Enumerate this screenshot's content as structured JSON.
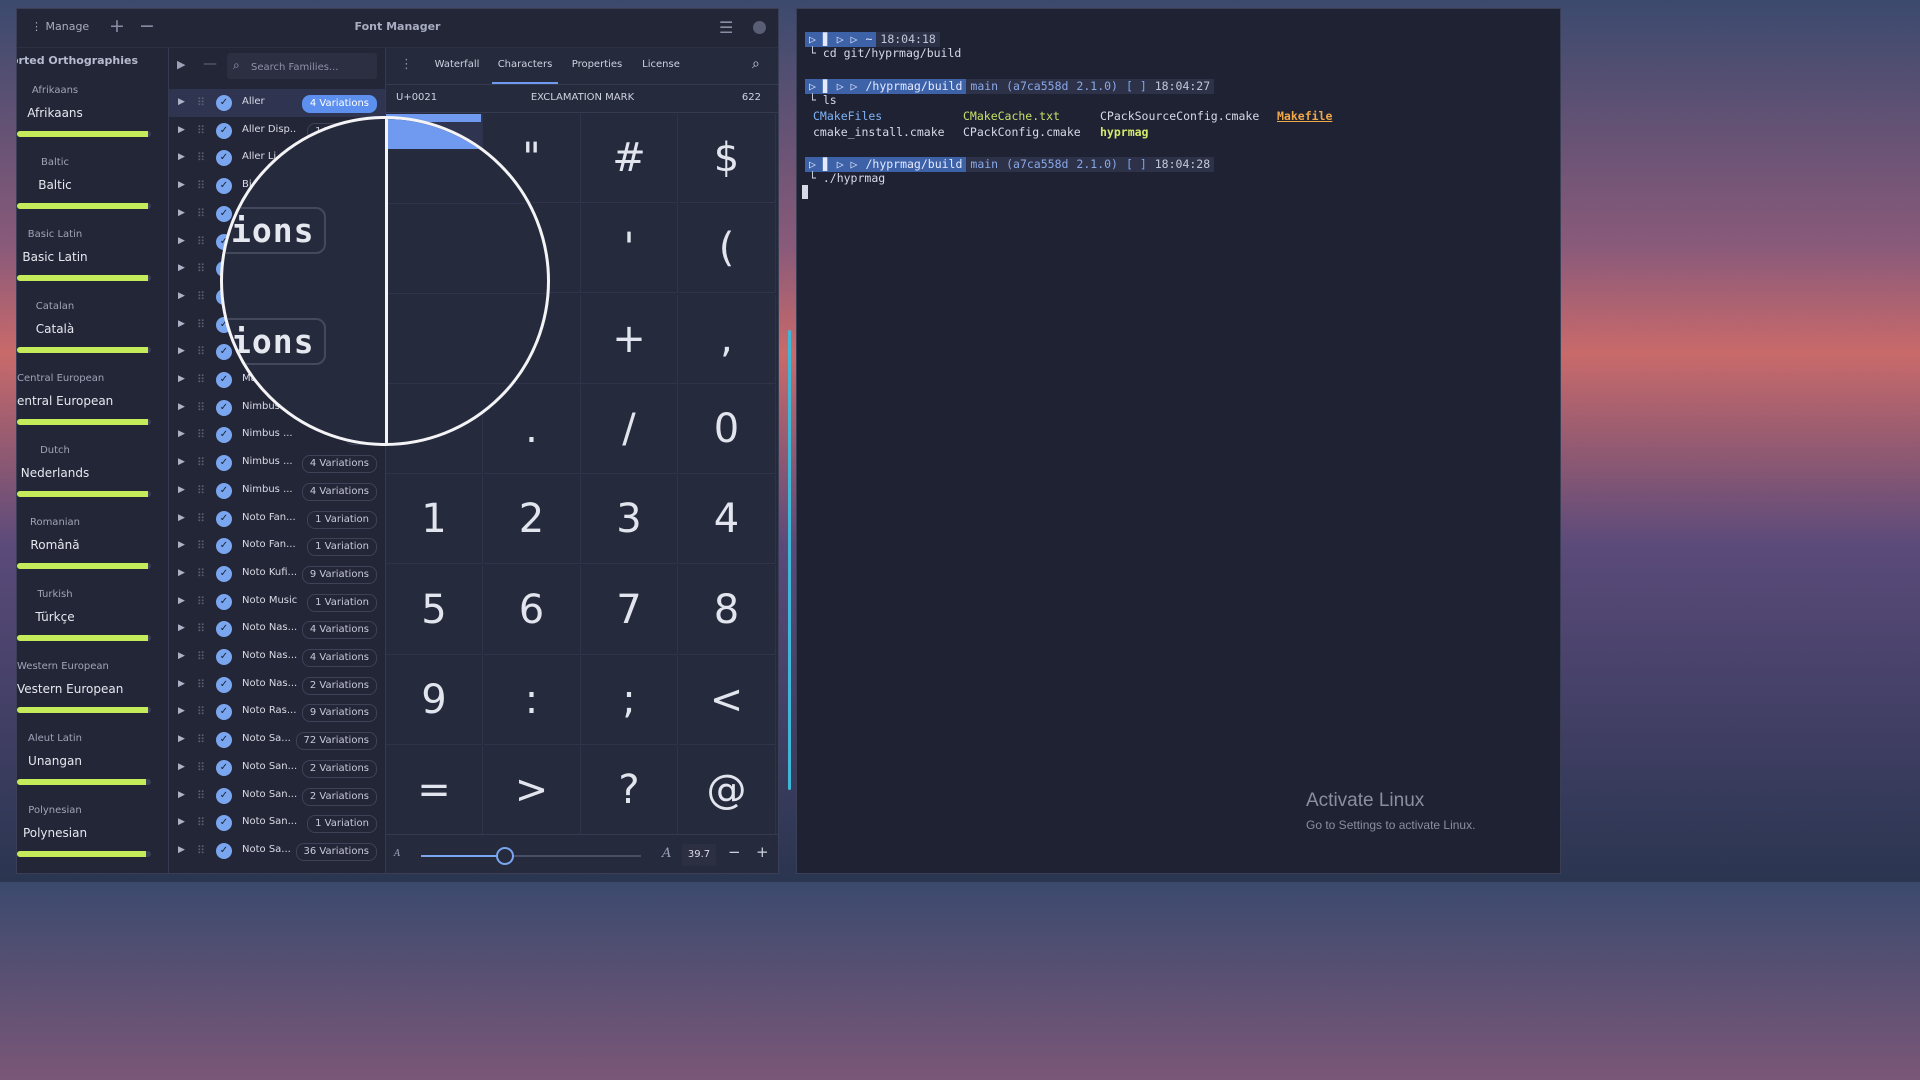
{
  "window": {
    "manage_label": "Manage",
    "title": "Font Manager"
  },
  "orthographies": {
    "heading": "orted Orthographies",
    "items": [
      {
        "label": "Afrikaans",
        "sample": "Afrikaans",
        "coverage": 0.98
      },
      {
        "label": "Baltic",
        "sample": "Baltic",
        "coverage": 0.98
      },
      {
        "label": "Basic Latin",
        "sample": "Basic Latin",
        "coverage": 0.98
      },
      {
        "label": "Catalan",
        "sample": "Català",
        "coverage": 0.98
      },
      {
        "label": "Central European",
        "sample": "entral European",
        "coverage": 0.98
      },
      {
        "label": "Dutch",
        "sample": "Nederlands",
        "coverage": 0.98
      },
      {
        "label": "Romanian",
        "sample": "Română",
        "coverage": 0.98
      },
      {
        "label": "Turkish",
        "sample": "Türkçe",
        "coverage": 0.98
      },
      {
        "label": "Western European",
        "sample": "Vestern European",
        "coverage": 0.98
      },
      {
        "label": "Aleut Latin",
        "sample": "Unangan",
        "coverage": 0.96
      },
      {
        "label": "Polynesian",
        "sample": "Polynesian",
        "coverage": 0.96
      }
    ]
  },
  "families": {
    "search_placeholder": "Search Families...",
    "rows": [
      {
        "name": "Aller",
        "badge": "4 Variations",
        "selected": true
      },
      {
        "name": "Aller Disp...",
        "badge": "1 Variation"
      },
      {
        "name": "Aller Li...",
        "badge": ""
      },
      {
        "name": "Bi...",
        "badge": ""
      },
      {
        "name": "",
        "badge": ""
      },
      {
        "name": "",
        "badge": ""
      },
      {
        "name": "",
        "badge": ""
      },
      {
        "name": "",
        "badge": ""
      },
      {
        "name": "",
        "badge": ""
      },
      {
        "name": "",
        "badge": ""
      },
      {
        "name": "Ma...",
        "badge": ""
      },
      {
        "name": "Nimbus",
        "badge": ""
      },
      {
        "name": "Nimbus ...",
        "badge": "4 V"
      },
      {
        "name": "Nimbus ...",
        "badge": "4 Variations"
      },
      {
        "name": "Nimbus ...",
        "badge": "4 Variations"
      },
      {
        "name": "Noto Fan...",
        "badge": "1 Variation"
      },
      {
        "name": "Noto Fan...",
        "badge": "1 Variation"
      },
      {
        "name": "Noto Kufi...",
        "badge": "9 Variations"
      },
      {
        "name": "Noto Music",
        "badge": "1 Variation"
      },
      {
        "name": "Noto Nas...",
        "badge": "4 Variations"
      },
      {
        "name": "Noto Nas...",
        "badge": "4 Variations"
      },
      {
        "name": "Noto Nas...",
        "badge": "2 Variations"
      },
      {
        "name": "Noto Ras...",
        "badge": "9 Variations"
      },
      {
        "name": "Noto Sa...",
        "badge": "72 Variations"
      },
      {
        "name": "Noto San...",
        "badge": "2 Variations"
      },
      {
        "name": "Noto San...",
        "badge": "2 Variations"
      },
      {
        "name": "Noto San...",
        "badge": "1 Variation"
      },
      {
        "name": "Noto Sa...",
        "badge": "36 Variations"
      }
    ]
  },
  "tabs": [
    "Waterfall",
    "Characters",
    "Properties",
    "License"
  ],
  "active_tab": "Characters",
  "character_info": {
    "codepoint": "U+0021",
    "name": "EXCLAMATION MARK",
    "count": "622"
  },
  "characters": [
    "!",
    "\"",
    "#",
    "$",
    "%",
    "&",
    "'",
    "(",
    ")",
    "*",
    "+",
    ",",
    "-",
    ".",
    "/",
    "0",
    "1",
    "2",
    "3",
    "4",
    "5",
    "6",
    "7",
    "8",
    "9",
    ":",
    ";",
    "<",
    "=",
    ">",
    "?",
    "@"
  ],
  "preview_size": {
    "value_label": "39.7",
    "value": 39.7,
    "slider_fraction": 0.375
  },
  "magnifier": {
    "text_top": "ions",
    "text_bottom": "ions"
  },
  "terminal": {
    "prompts": [
      {
        "dir": "~",
        "time": "18:04:18",
        "command": "cd git/hyprmag/build",
        "branch": "",
        "hash": "",
        "version": ""
      },
      {
        "dir": "/hyprmag/build",
        "branch": "main",
        "hash": "(a7ca558d",
        "version": "2.1.0)",
        "bracket": "[  ]",
        "time": "18:04:27",
        "command": "ls"
      },
      {
        "dir": "/hyprmag/build",
        "branch": "main",
        "hash": "(a7ca558d",
        "version": "2.1.0)",
        "bracket": "[  ]",
        "time": "18:04:28",
        "command": "./hyprmag"
      }
    ],
    "ls_output": {
      "row1": [
        "CMakeFiles",
        "CMakeCache.txt",
        "CPackSourceConfig.cmake",
        "Makefile"
      ],
      "row2": [
        "cmake_install.cmake",
        "CPackConfig.cmake",
        "hyprmag"
      ]
    }
  },
  "watermark": {
    "title": "Activate Linux",
    "subtitle": "Go to Settings to activate Linux."
  },
  "colors": {
    "accent": "#6f9af0",
    "coverage_bar": "#c4ec5a",
    "window_bg": "#232637",
    "terminal_bg": "#1f2233"
  }
}
